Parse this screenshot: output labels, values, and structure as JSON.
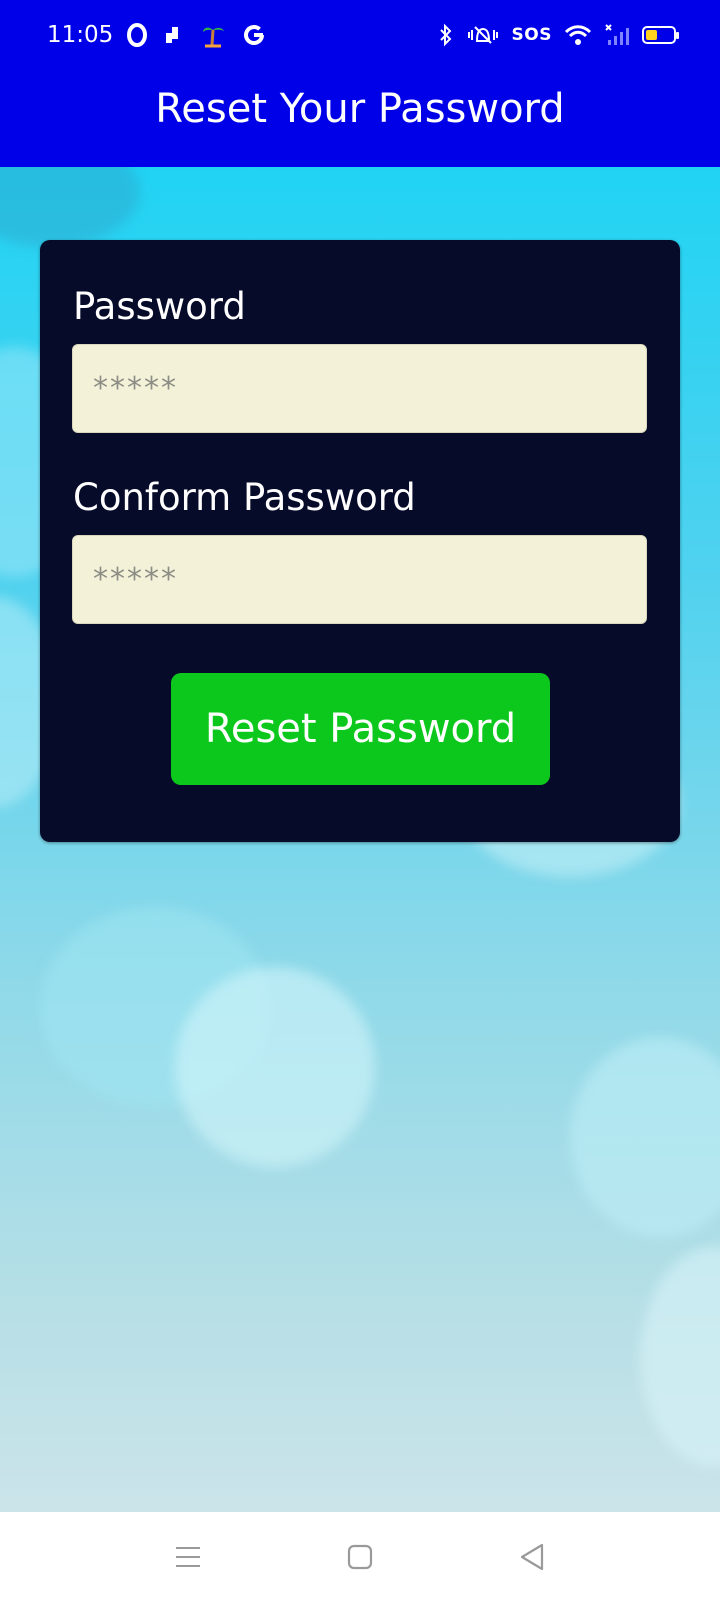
{
  "status_bar": {
    "time": "11:05",
    "sos": "SOS",
    "left_icons": [
      "opera-icon",
      "puzzle-icon",
      "palm-tree-icon",
      "google-icon"
    ],
    "right_icons": [
      "bluetooth-icon",
      "vibrate-silent-icon",
      "wifi-icon",
      "signal-icon",
      "battery-icon"
    ],
    "battery_color": "#ffd21f"
  },
  "header": {
    "title": "Reset Your Password",
    "background": "#0000e8"
  },
  "form": {
    "password_label": "Password",
    "password_placeholder": "*****",
    "confirm_label": "Conform Password",
    "confirm_placeholder": "*****",
    "submit_label": "Reset Password",
    "card_color": "#070b2a",
    "button_color": "#0cc81c",
    "field_color": "#f3f2d9"
  },
  "navigation": {
    "buttons": [
      "menu-icon",
      "home-icon",
      "back-icon"
    ]
  }
}
